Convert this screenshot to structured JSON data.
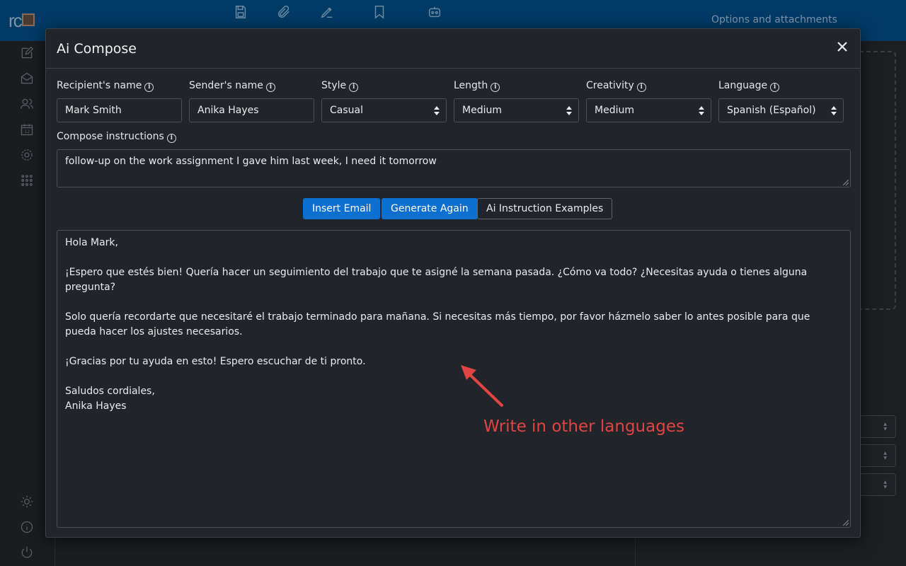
{
  "app": {
    "logo_text": "rc",
    "right_panel_title": "Options and attachments",
    "toolbar": [
      {
        "name": "save-icon",
        "label": "Save"
      },
      {
        "name": "paperclip-icon",
        "label": "Attach"
      },
      {
        "name": "signature-icon",
        "label": "Signature"
      },
      {
        "name": "bookmark-icon",
        "label": "Responses"
      },
      {
        "name": "robot-icon",
        "label": "AiCompose"
      }
    ],
    "sidebar_icons": [
      "compose-icon",
      "mail-icon",
      "contacts-icon",
      "calendar-icon",
      "settings-icon",
      "apps-grid-icon",
      "theme-sun-icon",
      "about-info-icon",
      "logout-power-icon"
    ]
  },
  "modal": {
    "title": "Ai Compose",
    "fields": {
      "recipient": {
        "label": "Recipient's name",
        "value": "Mark Smith"
      },
      "sender": {
        "label": "Sender's name",
        "value": "Anika Hayes"
      },
      "style": {
        "label": "Style",
        "value": "Casual"
      },
      "length": {
        "label": "Length",
        "value": "Medium"
      },
      "creativity": {
        "label": "Creativity",
        "value": "Medium"
      },
      "language": {
        "label": "Language",
        "value": "Spanish (Español)"
      }
    },
    "instructions": {
      "label": "Compose instructions",
      "value": "follow-up on the work assignment I gave him last week, I need it tomorrow"
    },
    "buttons": {
      "insert": "Insert Email",
      "generate": "Generate Again",
      "examples": "Ai Instruction Examples"
    },
    "email_lines": [
      "Hola Mark,",
      "",
      "¡Espero que estés bien! Quería hacer un seguimiento del trabajo que te asigné la semana pasada. ¿Cómo va todo? ¿Necesitas ayuda o tienes alguna pregunta?",
      "",
      "Solo quería recordarte que necesitaré el trabajo terminado para mañana. Si necesitas más tiempo, por favor házmelo saber lo antes posible para que pueda hacer los ajustes necesarios.",
      "",
      "¡Gracias por tu ayuda en esto! Espero escuchar de ti pronto.",
      "",
      "Saludos cordiales,",
      "Anika Hayes"
    ]
  },
  "annotation": {
    "text": "Write in other languages",
    "color": "#e04444"
  },
  "colors": {
    "topbar": "#003b66",
    "primary": "#0d6fcf",
    "modal_bg": "#212529"
  }
}
